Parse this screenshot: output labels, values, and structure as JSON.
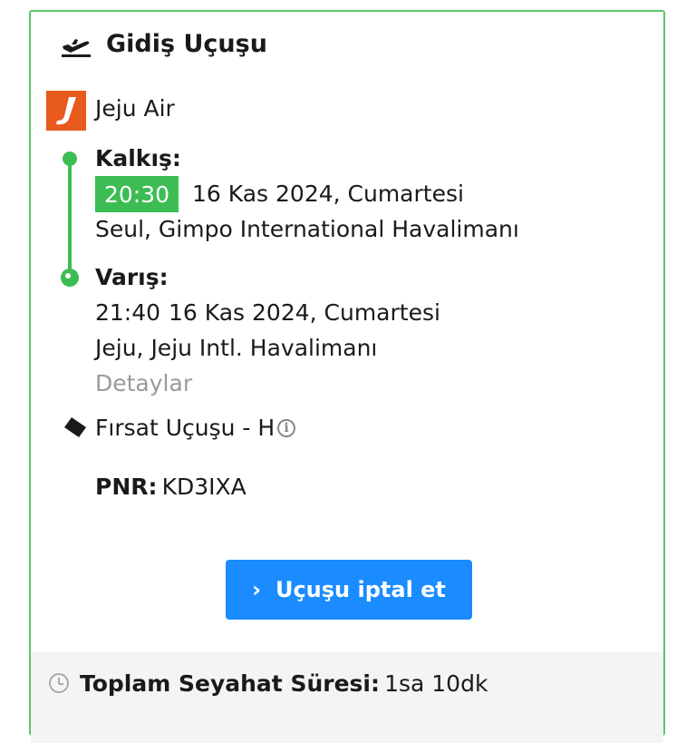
{
  "header": {
    "title": "Gidiş Uçuşu",
    "icon": "plane-departure-icon"
  },
  "airline": {
    "name": "Jeju Air",
    "logo": "J",
    "logo_color": "#e95a1d"
  },
  "departure": {
    "label": "Kalkış:",
    "time": "20:30",
    "date": "16 Kas 2024, Cumartesi",
    "airport": "Seul, Gimpo International Havalimanı"
  },
  "arrival": {
    "label": "Varış:",
    "time": "21:40",
    "date": "16 Kas 2024, Cumartesi",
    "airport": "Jeju, Jeju Intl. Havalimanı"
  },
  "details_link": "Detaylar",
  "fare": {
    "text": "Fırsat Uçuşu - H",
    "info_icon": "i"
  },
  "pnr": {
    "label": "PNR:",
    "value": "KD3IXA"
  },
  "cancel_button": {
    "label": "Uçuşu iptal et",
    "chevron": "›"
  },
  "total": {
    "label": "Toplam Seyahat Süresi:",
    "value": "1sa 10dk"
  },
  "colors": {
    "accent_green": "#3cbd53",
    "card_border": "#5cc56a",
    "button_blue": "#1a8cff"
  }
}
